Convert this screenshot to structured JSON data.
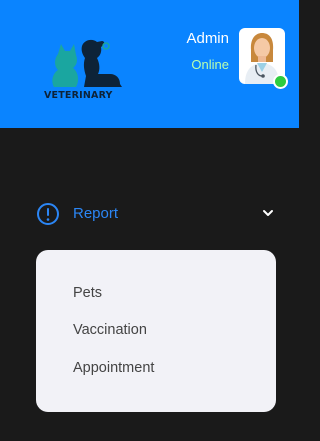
{
  "header": {
    "logo_text": "VETERINARY",
    "user_name": "Admin",
    "user_status": "Online",
    "background_color": "#0a84ff",
    "status_dot_color": "#2ecc40"
  },
  "menu": {
    "report": {
      "label": "Report",
      "icon": "alert-circle-icon",
      "expanded": true,
      "accent_color": "#2b86f5",
      "items": [
        {
          "label": "Pets"
        },
        {
          "label": "Vaccination"
        },
        {
          "label": "Appointment"
        }
      ]
    }
  }
}
